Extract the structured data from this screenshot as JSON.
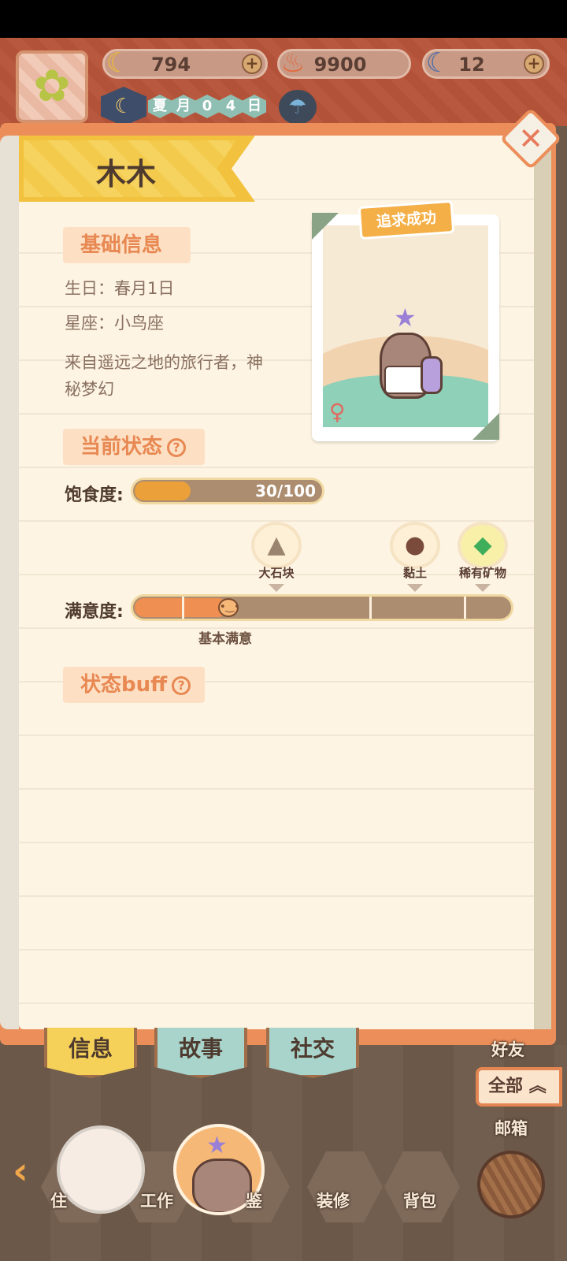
{
  "header": {
    "currencies": [
      {
        "icon": "banana-icon",
        "value": "794"
      },
      {
        "icon": "fire-icon",
        "value": "9900"
      },
      {
        "icon": "blue-banana-icon",
        "value": "12"
      }
    ],
    "date": {
      "season": "夏",
      "month": "月",
      "d1": "0",
      "d2": "4",
      "day": "日"
    },
    "plus_label": "+"
  },
  "character": {
    "name": "木木",
    "status_stamp": "追求成功",
    "sections": {
      "basic": "基础信息",
      "current": "当前状态",
      "buff": "状态buff"
    },
    "birthday": "生日：春月1日",
    "zodiac": "星座：小鸟座",
    "description_line1": "来自遥远之地的旅行者，神",
    "description_line2": "秘梦幻",
    "gender": "female"
  },
  "status": {
    "satiety_label": "饱食度:",
    "satiety_text": "30/100",
    "satiety_fraction": 0.3,
    "satisfaction_label": "满意度:",
    "satisfaction_caption": "基本满意",
    "rewards": [
      {
        "label": "大石块",
        "icon": "big-rock-icon"
      },
      {
        "label": "黏土",
        "icon": "clay-icon"
      },
      {
        "label": "稀有矿物",
        "icon": "rare-mineral-icon"
      }
    ]
  },
  "tabs": [
    {
      "label": "信息",
      "active": true
    },
    {
      "label": "故事",
      "active": false
    },
    {
      "label": "社交",
      "active": false
    }
  ],
  "bottom_nav": {
    "all_label": "全部",
    "friends": "好友",
    "mailbox": "邮箱",
    "items": [
      "住",
      "工作",
      "鉴",
      "装修",
      "背包"
    ]
  },
  "colors": {
    "accent": "#ec8e5a",
    "ribbon": "#f2c23e",
    "satiety": "#eba03a"
  }
}
